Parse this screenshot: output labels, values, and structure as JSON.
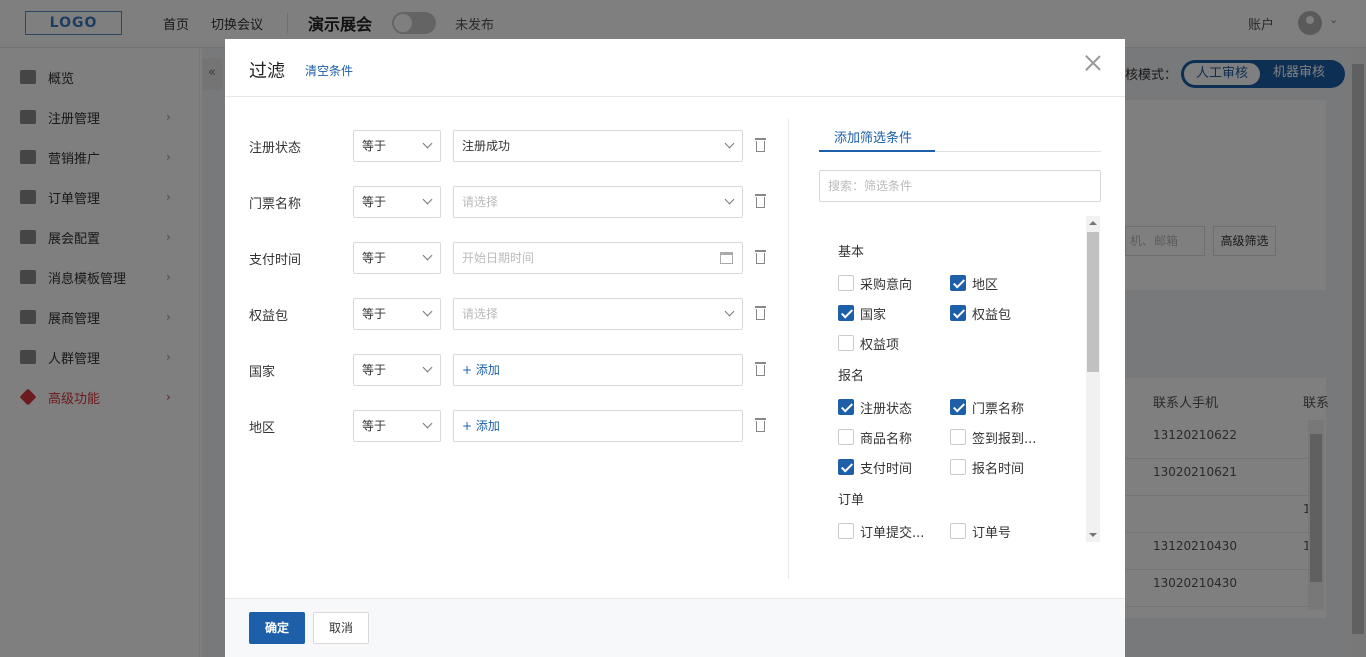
{
  "topbar": {
    "logo": "LOGO",
    "nav": [
      "首页",
      "切换会议"
    ],
    "expo_title": "演示展会",
    "publish_status": "未发布",
    "account": "账户"
  },
  "sidebar": {
    "items": [
      {
        "label": "概览",
        "icon": "overview-icon"
      },
      {
        "label": "注册管理",
        "icon": "user-register-icon"
      },
      {
        "label": "营销推广",
        "icon": "marketing-icon"
      },
      {
        "label": "订单管理",
        "icon": "order-icon"
      },
      {
        "label": "展会配置",
        "icon": "config-icon"
      },
      {
        "label": "消息模板管理",
        "icon": "bell-icon"
      },
      {
        "label": "展商管理",
        "icon": "exhibitor-icon"
      },
      {
        "label": "人群管理",
        "icon": "people-icon"
      },
      {
        "label": "高级功能",
        "icon": "tag-icon",
        "active": true
      }
    ]
  },
  "background": {
    "review_mode_label": "核模式：",
    "review_options": [
      "人工审核",
      "机器审核"
    ],
    "search_placeholder": "机、邮箱",
    "advanced_filter": "高级筛选",
    "table_header": [
      "联系人手机",
      "联系"
    ],
    "table_rows": [
      [
        "13120210622",
        ""
      ],
      [
        "13020210621",
        ""
      ],
      [
        "",
        "1"
      ],
      [
        "13120210430",
        "1"
      ],
      [
        "13020210430",
        ""
      ]
    ]
  },
  "modal": {
    "title": "过滤",
    "clear_label": "清空条件",
    "filters": [
      {
        "label": "注册状态",
        "operator": "等于",
        "value": "注册成功",
        "type": "select"
      },
      {
        "label": "门票名称",
        "operator": "等于",
        "value": "请选择",
        "type": "select-placeholder"
      },
      {
        "label": "支付时间",
        "operator": "等于",
        "value": "开始日期时间",
        "type": "date-placeholder"
      },
      {
        "label": "权益包",
        "operator": "等于",
        "value": "请选择",
        "type": "select-placeholder"
      },
      {
        "label": "国家",
        "operator": "等于",
        "value": "+ 添加",
        "type": "add"
      },
      {
        "label": "地区",
        "operator": "等于",
        "value": "+ 添加",
        "type": "add"
      }
    ],
    "right_panel": {
      "tab": "添加筛选条件",
      "search_placeholder": "搜索：筛选条件",
      "groups": [
        {
          "name": "基本",
          "options": [
            {
              "label": "采购意向",
              "checked": false
            },
            {
              "label": "地区",
              "checked": true
            },
            {
              "label": "国家",
              "checked": true
            },
            {
              "label": "权益包",
              "checked": true
            },
            {
              "label": "权益项",
              "checked": false
            }
          ]
        },
        {
          "name": "报名",
          "options": [
            {
              "label": "注册状态",
              "checked": true
            },
            {
              "label": "门票名称",
              "checked": true
            },
            {
              "label": "商品名称",
              "checked": false
            },
            {
              "label": "签到报到...",
              "checked": false
            },
            {
              "label": "支付时间",
              "checked": true
            },
            {
              "label": "报名时间",
              "checked": false
            }
          ]
        },
        {
          "name": "订单",
          "options": [
            {
              "label": "订单提交...",
              "checked": false
            },
            {
              "label": "订单号",
              "checked": false
            }
          ]
        }
      ]
    },
    "footer": {
      "ok": "确定",
      "cancel": "取消"
    }
  },
  "colors": {
    "primary": "#1d5fa8",
    "active_menu": "#d9363e"
  }
}
